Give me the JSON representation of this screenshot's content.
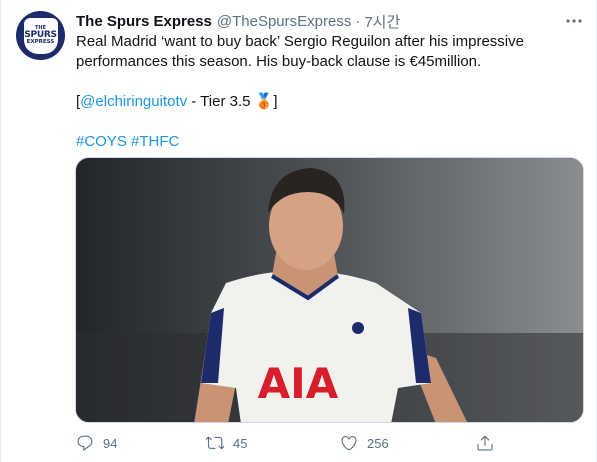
{
  "tweet": {
    "author": {
      "name": "The Spurs Express",
      "handle": "@TheSpursExpress",
      "avatar_text": [
        "THE",
        "SPURS",
        "EXPRESS"
      ]
    },
    "separator": "·",
    "timestamp": "7시간",
    "body": {
      "line1": "Real Madrid ‘want to buy back’ Sergio Reguilon after his impressive",
      "line2": "performances this season. His buy-back clause is €45million.",
      "source_open": "[",
      "source_link": "@elchiringuitotv",
      "source_tier": " - Tier 3.5 ",
      "source_medal": "🥉",
      "source_close": "]",
      "hashtag1": "#COYS",
      "hashtag2": "#THFC"
    },
    "media": {
      "shirt_sponsor": "AIA"
    },
    "actions": {
      "reply_count": "94",
      "retweet_count": "45",
      "like_count": "256"
    }
  },
  "colors": {
    "link": "#1b95e0",
    "secondary_text": "#5b7083",
    "avatar_bg": "#1d2a6b"
  },
  "icons": [
    "more-icon",
    "reply-icon",
    "retweet-icon",
    "like-icon",
    "share-icon"
  ]
}
